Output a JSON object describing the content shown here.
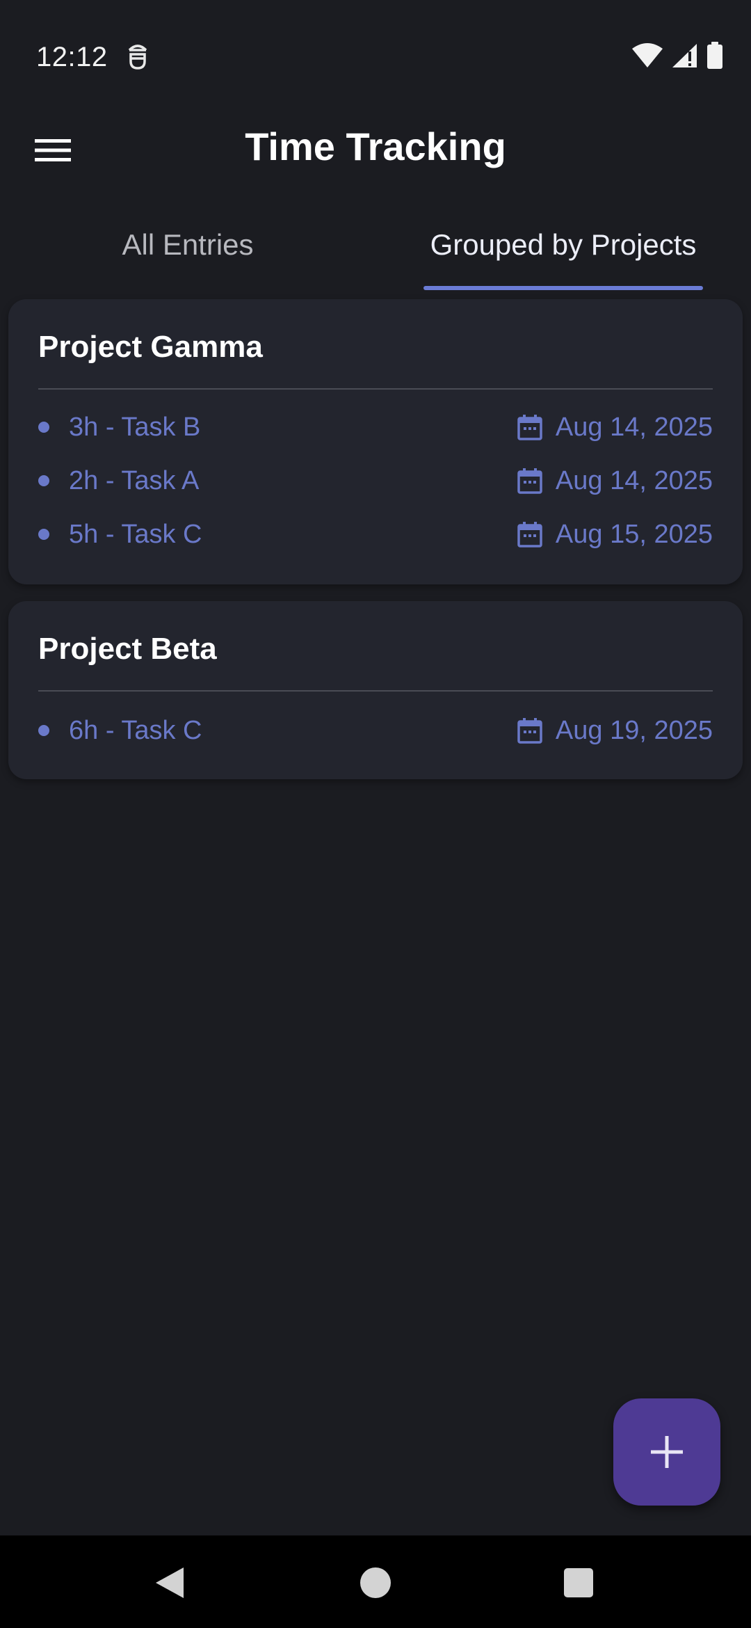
{
  "status_bar": {
    "time": "12:12"
  },
  "app_bar": {
    "title": "Time Tracking"
  },
  "tabs": [
    {
      "label": "All Entries",
      "selected": false
    },
    {
      "label": "Grouped by Projects",
      "selected": true
    }
  ],
  "projects": [
    {
      "name": "Project Gamma",
      "entries": [
        {
          "label": "3h - Task B",
          "date": "Aug 14, 2025"
        },
        {
          "label": "2h - Task A",
          "date": "Aug 14, 2025"
        },
        {
          "label": "5h - Task C",
          "date": "Aug 15, 2025"
        }
      ]
    },
    {
      "name": "Project Beta",
      "entries": [
        {
          "label": "6h - Task C",
          "date": "Aug 19, 2025"
        }
      ]
    }
  ],
  "icons": {
    "menu": "menu-icon",
    "calendar": "calendar-icon",
    "add": "add-icon",
    "wifi": "wifi-icon",
    "signal": "signal-icon",
    "battery": "battery-icon"
  },
  "colors": {
    "background": "#1b1c21",
    "card": "#23252e",
    "accent": "#6a79c9",
    "fab": "#4e3a94"
  }
}
